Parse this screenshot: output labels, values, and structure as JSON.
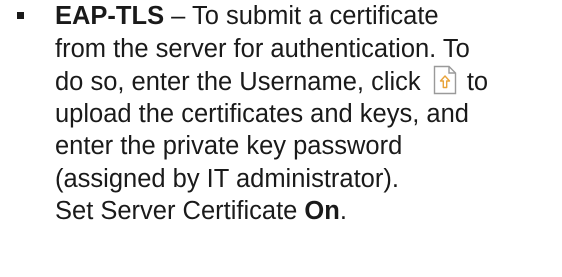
{
  "bullet": {
    "term": "EAP-TLS",
    "line1_rest": " – To submit a certificate",
    "line2": "from the server for authentication. To",
    "line3_before_icon": "do so, enter the Username, click ",
    "icon": "upload-file-icon",
    "line3_after_icon": " to",
    "line4": "upload the certificates and keys, and",
    "line5": "enter the private key password",
    "line6": "(assigned by IT administrator).",
    "line7_before": "Set Server Certificate ",
    "line7_bold": "On",
    "line7_after": "."
  },
  "colors": {
    "text": "#1a1a1a",
    "icon_outline": "#9a9a9a",
    "icon_accent": "#e8a33a"
  }
}
